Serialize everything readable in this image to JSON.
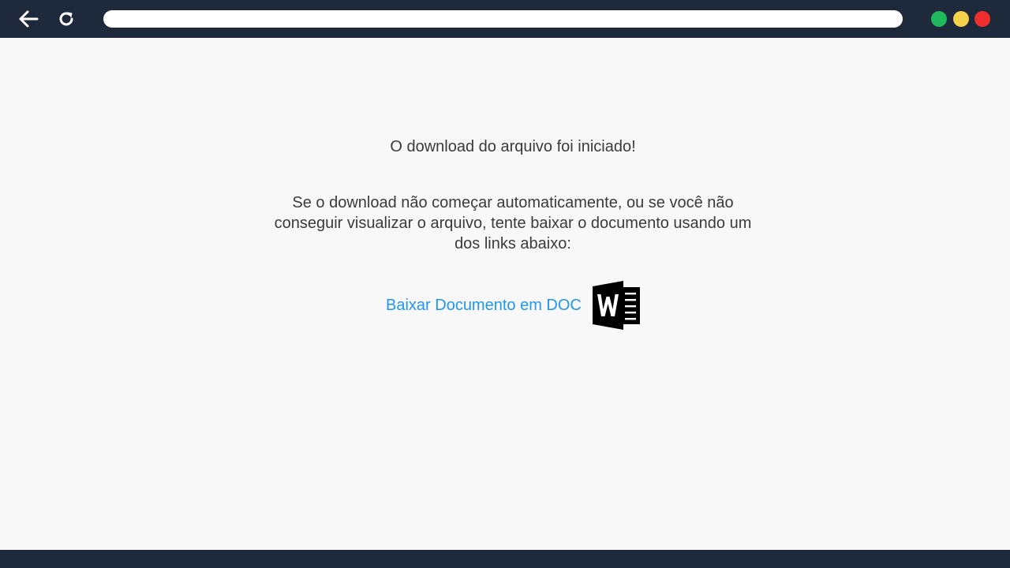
{
  "browser": {
    "back_icon": "arrow-left-icon",
    "reload_icon": "reload-icon",
    "address": "",
    "window_controls": [
      {
        "name": "green",
        "color": "#1fb85a"
      },
      {
        "name": "yellow",
        "color": "#f6d24a"
      },
      {
        "name": "red",
        "color": "#ee2e2e"
      }
    ],
    "chrome_color": "#1e293b"
  },
  "page": {
    "headline": "O download do arquivo foi iniciado!",
    "instructions": "Se o download não começar automaticamente, ou se você não conseguir visualizar o arquivo, tente baixar o documento usando um dos links abaixo:",
    "download_link": "Baixar Documento em DOC",
    "download_icon": "word-document-icon",
    "link_color": "#2196f3",
    "text_color": "#3a3a3a",
    "background": "#f8f8f8"
  }
}
